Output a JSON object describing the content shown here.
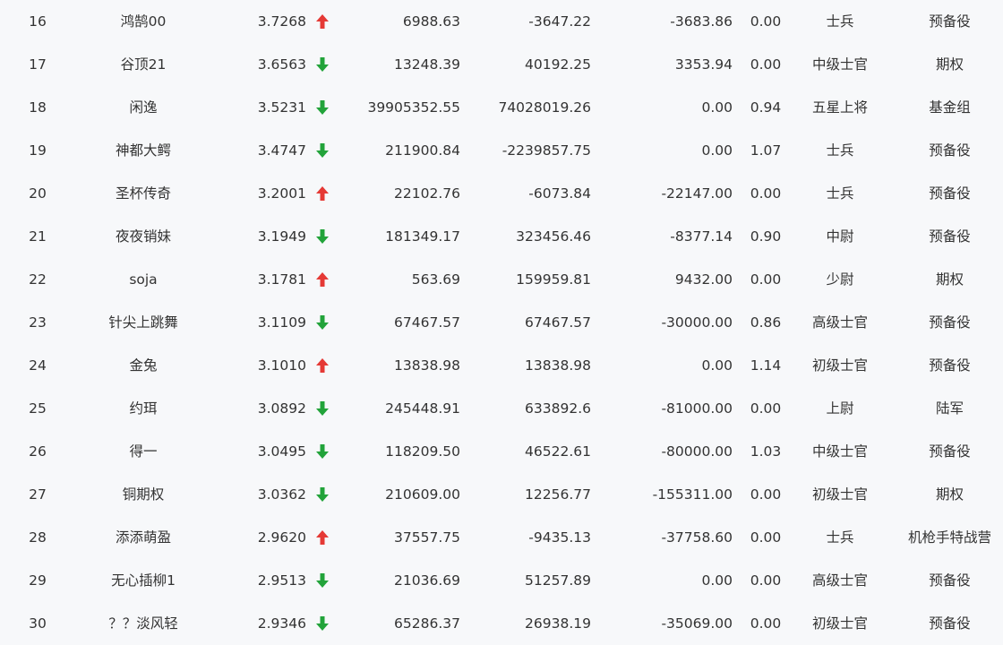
{
  "colors": {
    "up": "#e53935",
    "down": "#22a33a",
    "text": "#333333",
    "background": "#f7f8fa"
  },
  "rows": [
    {
      "rank": "16",
      "name": "鸿鹄00",
      "score": "3.7268",
      "trend": "up",
      "v1": "6988.63",
      "v2": "-3647.22",
      "v3": "-3683.86",
      "ratio": "0.00",
      "rank_title": "士兵",
      "team": "预备役"
    },
    {
      "rank": "17",
      "name": "谷顶21",
      "score": "3.6563",
      "trend": "down",
      "v1": "13248.39",
      "v2": "40192.25",
      "v3": "3353.94",
      "ratio": "0.00",
      "rank_title": "中级士官",
      "team": "期权"
    },
    {
      "rank": "18",
      "name": "闲逸",
      "score": "3.5231",
      "trend": "down",
      "v1": "39905352.55",
      "v2": "74028019.26",
      "v3": "0.00",
      "ratio": "0.94",
      "rank_title": "五星上将",
      "team": "基金组"
    },
    {
      "rank": "19",
      "name": "神都大鳄",
      "score": "3.4747",
      "trend": "down",
      "v1": "211900.84",
      "v2": "-2239857.75",
      "v3": "0.00",
      "ratio": "1.07",
      "rank_title": "士兵",
      "team": "预备役"
    },
    {
      "rank": "20",
      "name": "圣杯传奇",
      "score": "3.2001",
      "trend": "up",
      "v1": "22102.76",
      "v2": "-6073.84",
      "v3": "-22147.00",
      "ratio": "0.00",
      "rank_title": "士兵",
      "team": "预备役"
    },
    {
      "rank": "21",
      "name": "夜夜销妹",
      "score": "3.1949",
      "trend": "down",
      "v1": "181349.17",
      "v2": "323456.46",
      "v3": "-8377.14",
      "ratio": "0.90",
      "rank_title": "中尉",
      "team": "预备役"
    },
    {
      "rank": "22",
      "name": "soja",
      "score": "3.1781",
      "trend": "up",
      "v1": "563.69",
      "v2": "159959.81",
      "v3": "9432.00",
      "ratio": "0.00",
      "rank_title": "少尉",
      "team": "期权"
    },
    {
      "rank": "23",
      "name": "针尖上跳舞",
      "score": "3.1109",
      "trend": "down",
      "v1": "67467.57",
      "v2": "67467.57",
      "v3": "-30000.00",
      "ratio": "0.86",
      "rank_title": "高级士官",
      "team": "预备役"
    },
    {
      "rank": "24",
      "name": "金兔",
      "score": "3.1010",
      "trend": "up",
      "v1": "13838.98",
      "v2": "13838.98",
      "v3": "0.00",
      "ratio": "1.14",
      "rank_title": "初级士官",
      "team": "预备役"
    },
    {
      "rank": "25",
      "name": "约珥",
      "score": "3.0892",
      "trend": "down",
      "v1": "245448.91",
      "v2": "633892.6",
      "v3": "-81000.00",
      "ratio": "0.00",
      "rank_title": "上尉",
      "team": "陆军"
    },
    {
      "rank": "26",
      "name": "得一",
      "score": "3.0495",
      "trend": "down",
      "v1": "118209.50",
      "v2": "46522.61",
      "v3": "-80000.00",
      "ratio": "1.03",
      "rank_title": "中级士官",
      "team": "预备役"
    },
    {
      "rank": "27",
      "name": "铜期权",
      "score": "3.0362",
      "trend": "down",
      "v1": "210609.00",
      "v2": "12256.77",
      "v3": "-155311.00",
      "ratio": "0.00",
      "rank_title": "初级士官",
      "team": "期权"
    },
    {
      "rank": "28",
      "name": "添添萌盈",
      "score": "2.9620",
      "trend": "up",
      "v1": "37557.75",
      "v2": "-9435.13",
      "v3": "-37758.60",
      "ratio": "0.00",
      "rank_title": "士兵",
      "team": "机枪手特战营"
    },
    {
      "rank": "29",
      "name": "无心插柳1",
      "score": "2.9513",
      "trend": "down",
      "v1": "21036.69",
      "v2": "51257.89",
      "v3": "0.00",
      "ratio": "0.00",
      "rank_title": "高级士官",
      "team": "预备役"
    },
    {
      "rank": "30",
      "name": "？？淡风轻",
      "score": "2.9346",
      "trend": "down",
      "v1": "65286.37",
      "v2": "26938.19",
      "v3": "-35069.00",
      "ratio": "0.00",
      "rank_title": "初级士官",
      "team": "预备役"
    }
  ]
}
